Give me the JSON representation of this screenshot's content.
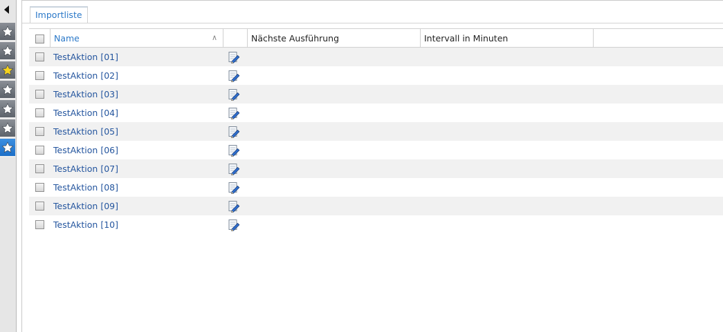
{
  "sidebar": {
    "buttons": [
      {
        "icon": "star-white-icon",
        "color": "#ffffff",
        "active": false
      },
      {
        "icon": "star-white-icon",
        "color": "#ffffff",
        "active": false
      },
      {
        "icon": "star-yellow-icon",
        "color": "#f5d21e",
        "active": false
      },
      {
        "icon": "star-white-icon",
        "color": "#ffffff",
        "active": false
      },
      {
        "icon": "star-white-icon",
        "color": "#ffffff",
        "active": false
      },
      {
        "icon": "star-white-icon",
        "color": "#ffffff",
        "active": false
      },
      {
        "icon": "star-white-icon",
        "color": "#ffffff",
        "active": true
      }
    ]
  },
  "tab": {
    "label": "Importliste"
  },
  "grid": {
    "columns": {
      "name": "Name",
      "next_run": "Nächste Ausführung",
      "interval": "Intervall in Minuten"
    },
    "rows": [
      {
        "name": "TestAktion [01]",
        "next_run": "",
        "interval": ""
      },
      {
        "name": "TestAktion [02]",
        "next_run": "",
        "interval": ""
      },
      {
        "name": "TestAktion [03]",
        "next_run": "",
        "interval": ""
      },
      {
        "name": "TestAktion [04]",
        "next_run": "",
        "interval": ""
      },
      {
        "name": "TestAktion [05]",
        "next_run": "",
        "interval": ""
      },
      {
        "name": "TestAktion [06]",
        "next_run": "",
        "interval": ""
      },
      {
        "name": "TestAktion [07]",
        "next_run": "",
        "interval": ""
      },
      {
        "name": "TestAktion [08]",
        "next_run": "",
        "interval": ""
      },
      {
        "name": "TestAktion [09]",
        "next_run": "",
        "interval": ""
      },
      {
        "name": "TestAktion [10]",
        "next_run": "",
        "interval": ""
      }
    ]
  },
  "colors": {
    "accent": "#2a78c8",
    "link": "#24559e",
    "row_alt": "#f1f1f1",
    "rail": "#e6e6e6"
  }
}
